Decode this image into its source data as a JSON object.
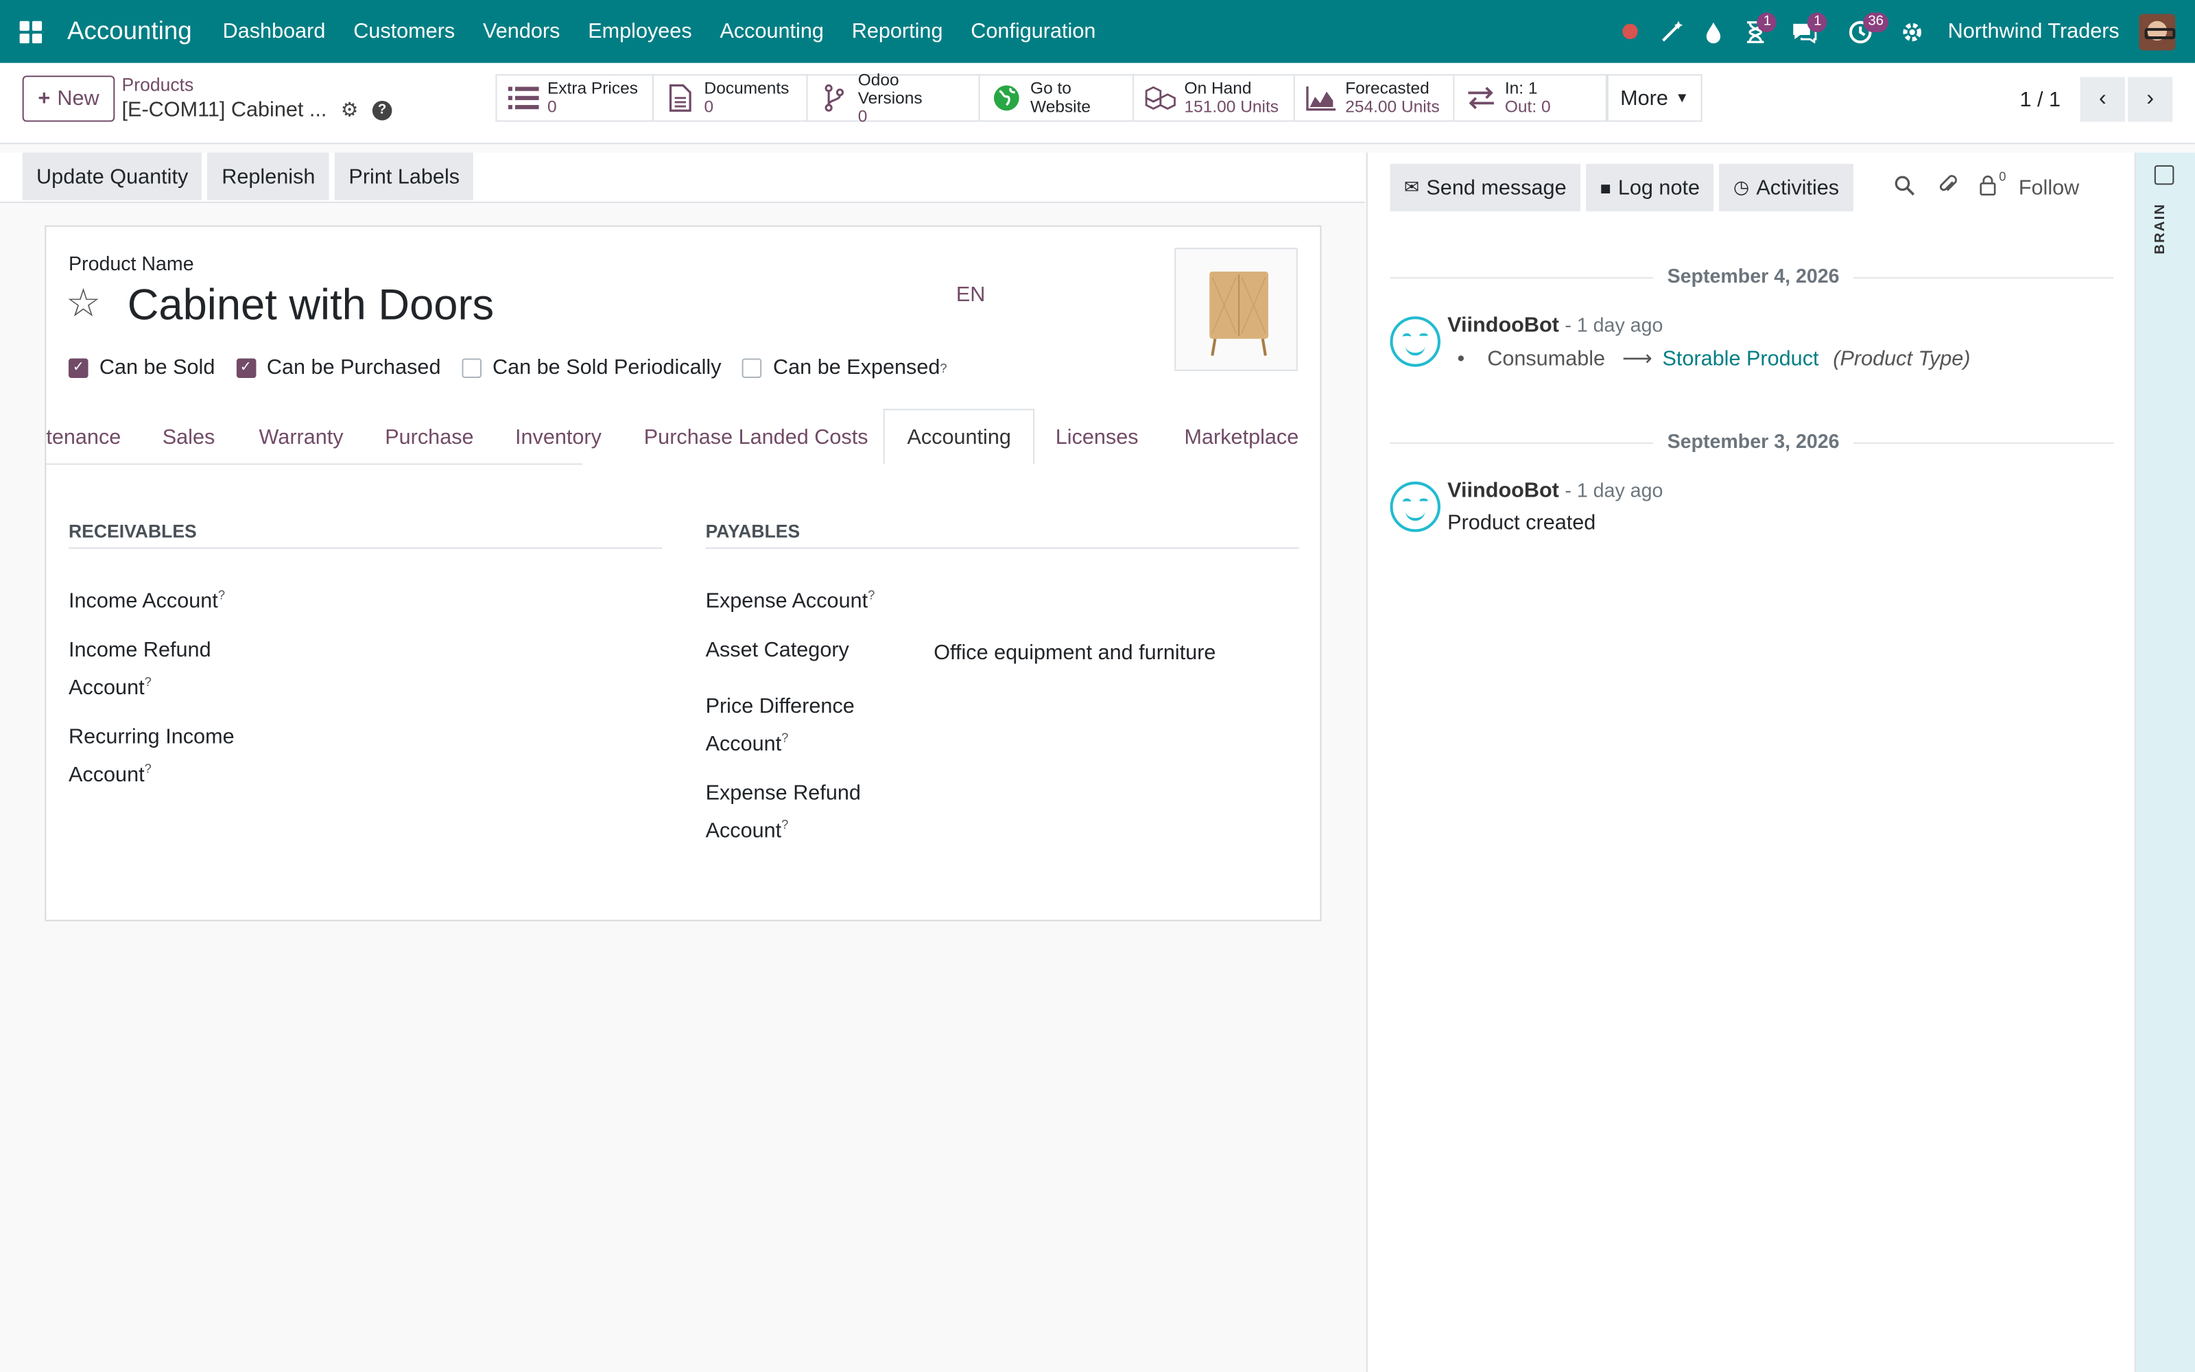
{
  "navbar": {
    "app_name": "Accounting",
    "menu": [
      "Dashboard",
      "Customers",
      "Vendors",
      "Employees",
      "Accounting",
      "Reporting",
      "Configuration"
    ],
    "badges": {
      "activity": "1",
      "messages": "1",
      "clock": "36"
    },
    "company": "Northwind Traders",
    "icons": [
      "apps-icon",
      "record-dot-icon",
      "magic-wand-icon",
      "drop-icon",
      "hourglass-icon",
      "chat-icon",
      "clock-icon",
      "settings-icon"
    ]
  },
  "control_panel": {
    "new_label": "New",
    "breadcrumb_parent": "Products",
    "breadcrumb_current": "[E-COM11] Cabinet ...",
    "smart_buttons": [
      {
        "label": "Extra Prices",
        "value": "0",
        "icon": "list-icon"
      },
      {
        "label": "Documents",
        "value": "0",
        "icon": "document-icon"
      },
      {
        "label": "Odoo Versions",
        "value": "0",
        "icon": "branch-icon"
      },
      {
        "label": "Go to",
        "value": "Website",
        "icon": "globe-icon"
      },
      {
        "label": "On Hand",
        "value": "151.00 Units",
        "icon": "cubes-icon"
      },
      {
        "label": "Forecasted",
        "value": "254.00 Units",
        "icon": "area-chart-icon"
      },
      {
        "label": "In: 1",
        "value": "Out: 0",
        "icon": "transfer-icon"
      }
    ],
    "more_label": "More",
    "pager": "1 / 1"
  },
  "statusbar": {
    "buttons": [
      "Update Quantity",
      "Replenish",
      "Print Labels"
    ]
  },
  "form": {
    "product_name_label": "Product Name",
    "product_name": "Cabinet with Doors",
    "lang": "EN",
    "checkboxes": [
      {
        "label": "Can be Sold",
        "checked": true
      },
      {
        "label": "Can be Purchased",
        "checked": true
      },
      {
        "label": "Can be Sold Periodically",
        "checked": false
      },
      {
        "label": "Can be Expensed",
        "checked": false
      }
    ],
    "tabs": [
      "tenance",
      "Sales",
      "Warranty",
      "Purchase",
      "Inventory",
      "Purchase Landed Costs",
      "Accounting",
      "Licenses",
      "Marketplace"
    ],
    "active_tab": "Accounting",
    "receivables": {
      "title": "RECEIVABLES",
      "fields": [
        "Income Account",
        "Income Refund",
        "Account",
        "Recurring Income",
        "Account"
      ]
    },
    "payables": {
      "title": "PAYABLES",
      "fields": [
        "Expense Account",
        "Asset Category",
        "Price Difference",
        "Account",
        "Expense Refund",
        "Account"
      ],
      "asset_category_value": "Office equipment and furniture"
    }
  },
  "chatter": {
    "buttons": [
      "Send message",
      "Log note",
      "Activities"
    ],
    "followers_count": "0",
    "follow_label": "Follow",
    "groups": [
      {
        "date": "September 4, 2026",
        "author": "ViindooBot",
        "time": "- 1 day ago",
        "old_value": "Consumable",
        "new_value": "Storable Product",
        "field": "(Product Type)"
      },
      {
        "date": "September 3, 2026",
        "author": "ViindooBot",
        "time": "- 1 day ago",
        "body": "Product created"
      }
    ]
  },
  "side_panel": {
    "label": "BRAIN"
  },
  "colors": {
    "navbar": "#017e84",
    "primary": "#714b67",
    "link": "#017e84",
    "bot": "#22bbd0"
  }
}
